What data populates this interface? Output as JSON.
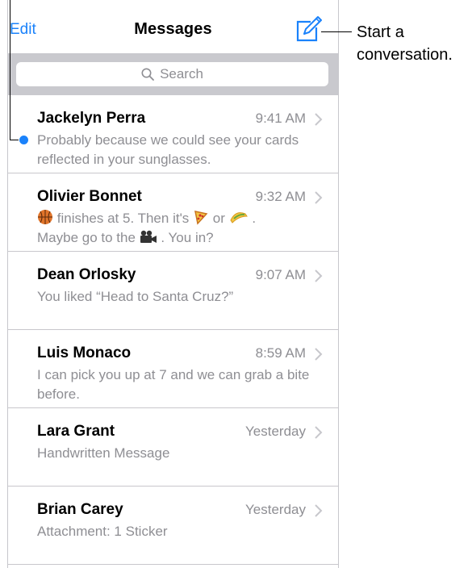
{
  "navbar": {
    "edit_label": "Edit",
    "title": "Messages",
    "compose_icon": "compose-icon"
  },
  "search": {
    "placeholder": "Search",
    "icon": "search-icon"
  },
  "messages": [
    {
      "sender": "Jackelyn Perra",
      "time": "9:41 AM",
      "preview": "Probably because we could see your cards reflected in your sunglasses.",
      "unread": true
    },
    {
      "sender": "Olivier Bonnet",
      "time": "9:32 AM",
      "preview_parts": {
        "a": "finishes at 5. Then it's",
        "b": "or",
        "c": ".",
        "d": "Maybe go to the",
        "e": ". You in?"
      },
      "emojis": [
        "basketball",
        "pizza",
        "taco",
        "movie-camera"
      ]
    },
    {
      "sender": "Dean Orlosky",
      "time": "9:07 AM",
      "preview": "You liked “Head to Santa Cruz?”"
    },
    {
      "sender": "Luis Monaco",
      "time": "8:59 AM",
      "preview": "I can pick you up at 7 and we can grab a bite before."
    },
    {
      "sender": "Lara Grant",
      "time": "Yesterday",
      "preview": "Handwritten Message"
    },
    {
      "sender": "Brian Carey",
      "time": "Yesterday",
      "preview": "Attachment: 1 Sticker"
    }
  ],
  "callouts": {
    "compose": "Start a\nconversation."
  },
  "colors": {
    "accent": "#1a82fb",
    "search_bar_bg": "#c9c9ce",
    "secondary_text": "#8e8e93"
  }
}
